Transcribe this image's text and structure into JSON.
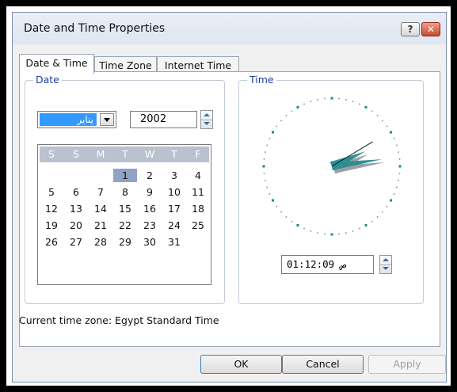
{
  "window": {
    "title": "Date and Time Properties",
    "help_button": "?",
    "close_button": "✕"
  },
  "tabs": [
    {
      "label": "Date & Time",
      "active": true
    },
    {
      "label": "Time Zone",
      "active": false
    },
    {
      "label": "Internet Time",
      "active": false
    }
  ],
  "date_group": {
    "legend": "Date",
    "month": "يناير",
    "year": "2002",
    "weekdays": [
      "S",
      "S",
      "M",
      "T",
      "W",
      "T",
      "F"
    ],
    "days": [
      [
        "",
        "",
        "",
        "1",
        "2",
        "3",
        "4"
      ],
      [
        "5",
        "6",
        "7",
        "8",
        "9",
        "10",
        "11"
      ],
      [
        "12",
        "13",
        "14",
        "15",
        "16",
        "17",
        "18"
      ],
      [
        "19",
        "20",
        "21",
        "22",
        "23",
        "24",
        "25"
      ],
      [
        "26",
        "27",
        "28",
        "29",
        "30",
        "31",
        ""
      ]
    ],
    "selected_day": "1"
  },
  "time_group": {
    "legend": "Time",
    "time_value": "01:12:09 ص",
    "clock": {
      "hour": 1,
      "minute": 12,
      "second": 9
    }
  },
  "timezone_label": "Current time zone:  Egypt Standard Time",
  "buttons": {
    "ok": "OK",
    "cancel": "Cancel",
    "apply": "Apply"
  },
  "colors": {
    "selection": "#3399ff",
    "hand_primary": "#2e8f92",
    "hand_shadow": "#9aa0a6",
    "tick_accent": "#1a8a8a"
  },
  "icons": [
    "help-icon",
    "close-icon",
    "dropdown-arrow-icon",
    "spin-up-icon",
    "spin-down-icon"
  ]
}
